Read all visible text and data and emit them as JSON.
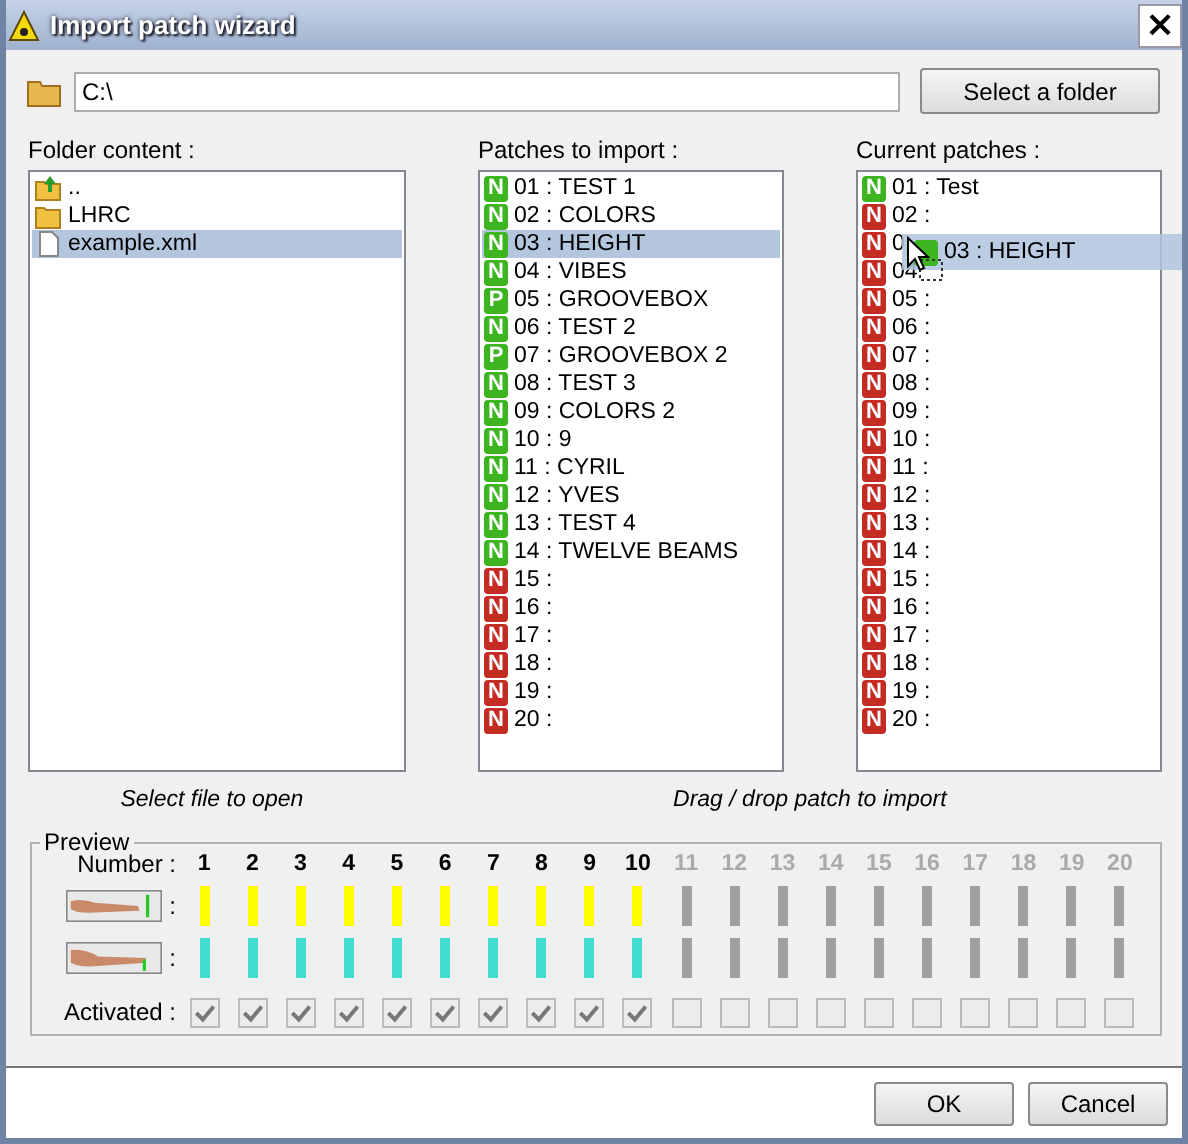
{
  "window": {
    "title": "Import patch wizard",
    "close": "×"
  },
  "path": {
    "value": "C:\\",
    "button": "Select a folder"
  },
  "folder": {
    "label": "Folder content :",
    "caption": "Select file to open",
    "items": [
      {
        "name": "..",
        "kind": "up",
        "selected": false
      },
      {
        "name": "LHRC",
        "kind": "folder",
        "selected": false
      },
      {
        "name": "example.xml",
        "kind": "file",
        "selected": true
      }
    ]
  },
  "import": {
    "label": "Patches to import :",
    "items": [
      {
        "badge": "N",
        "color": "#3cb521",
        "text": "01 : TEST 1",
        "selected": false
      },
      {
        "badge": "N",
        "color": "#3cb521",
        "text": "02 : COLORS",
        "selected": false
      },
      {
        "badge": "N",
        "color": "#3cb521",
        "text": "03 : HEIGHT",
        "selected": true
      },
      {
        "badge": "N",
        "color": "#3cb521",
        "text": "04 : VIBES",
        "selected": false
      },
      {
        "badge": "P",
        "color": "#3cb521",
        "text": "05 : GROOVEBOX",
        "selected": false
      },
      {
        "badge": "N",
        "color": "#3cb521",
        "text": "06 : TEST 2",
        "selected": false
      },
      {
        "badge": "P",
        "color": "#3cb521",
        "text": "07 : GROOVEBOX 2",
        "selected": false
      },
      {
        "badge": "N",
        "color": "#3cb521",
        "text": "08 : TEST 3",
        "selected": false
      },
      {
        "badge": "N",
        "color": "#3cb521",
        "text": "09 : COLORS 2",
        "selected": false
      },
      {
        "badge": "N",
        "color": "#3cb521",
        "text": "10 : 9",
        "selected": false
      },
      {
        "badge": "N",
        "color": "#3cb521",
        "text": "11 : CYRIL",
        "selected": false
      },
      {
        "badge": "N",
        "color": "#3cb521",
        "text": "12 : YVES",
        "selected": false
      },
      {
        "badge": "N",
        "color": "#3cb521",
        "text": "13 : TEST 4",
        "selected": false
      },
      {
        "badge": "N",
        "color": "#3cb521",
        "text": "14 : TWELVE BEAMS",
        "selected": false
      },
      {
        "badge": "N",
        "color": "#c42b22",
        "text": "15 :",
        "selected": false
      },
      {
        "badge": "N",
        "color": "#c42b22",
        "text": "16 :",
        "selected": false
      },
      {
        "badge": "N",
        "color": "#c42b22",
        "text": "17 :",
        "selected": false
      },
      {
        "badge": "N",
        "color": "#c42b22",
        "text": "18 :",
        "selected": false
      },
      {
        "badge": "N",
        "color": "#c42b22",
        "text": "19 :",
        "selected": false
      },
      {
        "badge": "N",
        "color": "#c42b22",
        "text": "20 :",
        "selected": false
      }
    ]
  },
  "current": {
    "label": "Current patches :",
    "caption": "Drag / drop patch to import",
    "items": [
      {
        "badge": "N",
        "color": "#3cb521",
        "text": "01 : Test"
      },
      {
        "badge": "N",
        "color": "#c42b22",
        "text": "02 :"
      },
      {
        "badge": "N",
        "color": "#c42b22",
        "text": "0"
      },
      {
        "badge": "N",
        "color": "#c42b22",
        "text": "04"
      },
      {
        "badge": "N",
        "color": "#c42b22",
        "text": "05 :"
      },
      {
        "badge": "N",
        "color": "#c42b22",
        "text": "06 :"
      },
      {
        "badge": "N",
        "color": "#c42b22",
        "text": "07 :"
      },
      {
        "badge": "N",
        "color": "#c42b22",
        "text": "08 :"
      },
      {
        "badge": "N",
        "color": "#c42b22",
        "text": "09 :"
      },
      {
        "badge": "N",
        "color": "#c42b22",
        "text": "10 :"
      },
      {
        "badge": "N",
        "color": "#c42b22",
        "text": "11 :"
      },
      {
        "badge": "N",
        "color": "#c42b22",
        "text": "12 :"
      },
      {
        "badge": "N",
        "color": "#c42b22",
        "text": "13 :"
      },
      {
        "badge": "N",
        "color": "#c42b22",
        "text": "14 :"
      },
      {
        "badge": "N",
        "color": "#c42b22",
        "text": "15 :"
      },
      {
        "badge": "N",
        "color": "#c42b22",
        "text": "16 :"
      },
      {
        "badge": "N",
        "color": "#c42b22",
        "text": "17 :"
      },
      {
        "badge": "N",
        "color": "#c42b22",
        "text": "18 :"
      },
      {
        "badge": "N",
        "color": "#c42b22",
        "text": "19 :"
      },
      {
        "badge": "N",
        "color": "#c42b22",
        "text": "20 :"
      }
    ],
    "drag": {
      "color": "#3cb521",
      "text": "03 : HEIGHT"
    }
  },
  "preview": {
    "title": "Preview",
    "number_label": "Number :",
    "row_label": ":",
    "activated_label": "Activated :",
    "channels": [
      {
        "number": "1",
        "active": true,
        "checked": true
      },
      {
        "number": "2",
        "active": true,
        "checked": true
      },
      {
        "number": "3",
        "active": true,
        "checked": true
      },
      {
        "number": "4",
        "active": true,
        "checked": true
      },
      {
        "number": "5",
        "active": true,
        "checked": true
      },
      {
        "number": "6",
        "active": true,
        "checked": true
      },
      {
        "number": "7",
        "active": true,
        "checked": true
      },
      {
        "number": "8",
        "active": true,
        "checked": true
      },
      {
        "number": "9",
        "active": true,
        "checked": true
      },
      {
        "number": "10",
        "active": true,
        "checked": true
      },
      {
        "number": "11",
        "active": false,
        "checked": false
      },
      {
        "number": "12",
        "active": false,
        "checked": false
      },
      {
        "number": "13",
        "active": false,
        "checked": false
      },
      {
        "number": "14",
        "active": false,
        "checked": false
      },
      {
        "number": "15",
        "active": false,
        "checked": false
      },
      {
        "number": "16",
        "active": false,
        "checked": false
      },
      {
        "number": "17",
        "active": false,
        "checked": false
      },
      {
        "number": "18",
        "active": false,
        "checked": false
      },
      {
        "number": "19",
        "active": false,
        "checked": false
      },
      {
        "number": "20",
        "active": false,
        "checked": false
      }
    ]
  },
  "buttons": [
    "OK",
    "Cancel"
  ]
}
